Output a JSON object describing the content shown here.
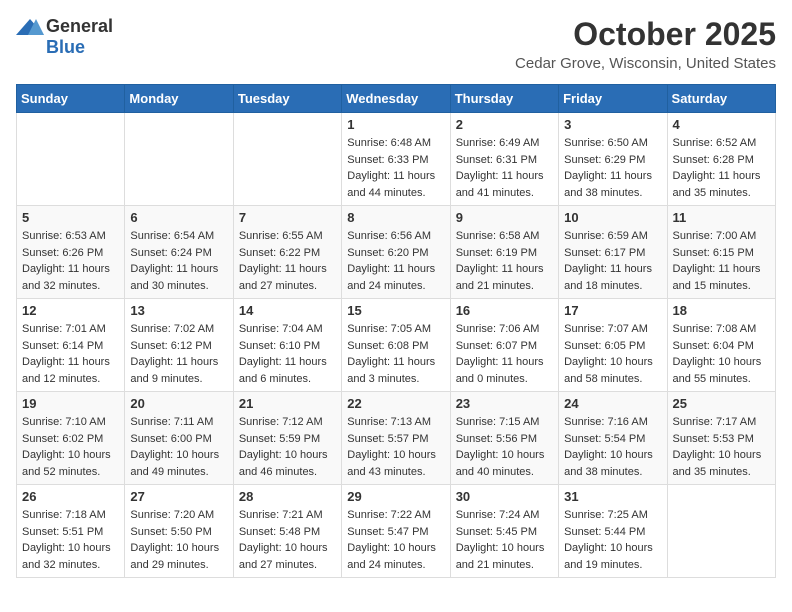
{
  "header": {
    "logo_general": "General",
    "logo_blue": "Blue",
    "month_title": "October 2025",
    "subtitle": "Cedar Grove, Wisconsin, United States"
  },
  "days_of_week": [
    "Sunday",
    "Monday",
    "Tuesday",
    "Wednesday",
    "Thursday",
    "Friday",
    "Saturday"
  ],
  "weeks": [
    [
      {
        "day": "",
        "info": ""
      },
      {
        "day": "",
        "info": ""
      },
      {
        "day": "",
        "info": ""
      },
      {
        "day": "1",
        "info": "Sunrise: 6:48 AM\nSunset: 6:33 PM\nDaylight: 11 hours\nand 44 minutes."
      },
      {
        "day": "2",
        "info": "Sunrise: 6:49 AM\nSunset: 6:31 PM\nDaylight: 11 hours\nand 41 minutes."
      },
      {
        "day": "3",
        "info": "Sunrise: 6:50 AM\nSunset: 6:29 PM\nDaylight: 11 hours\nand 38 minutes."
      },
      {
        "day": "4",
        "info": "Sunrise: 6:52 AM\nSunset: 6:28 PM\nDaylight: 11 hours\nand 35 minutes."
      }
    ],
    [
      {
        "day": "5",
        "info": "Sunrise: 6:53 AM\nSunset: 6:26 PM\nDaylight: 11 hours\nand 32 minutes."
      },
      {
        "day": "6",
        "info": "Sunrise: 6:54 AM\nSunset: 6:24 PM\nDaylight: 11 hours\nand 30 minutes."
      },
      {
        "day": "7",
        "info": "Sunrise: 6:55 AM\nSunset: 6:22 PM\nDaylight: 11 hours\nand 27 minutes."
      },
      {
        "day": "8",
        "info": "Sunrise: 6:56 AM\nSunset: 6:20 PM\nDaylight: 11 hours\nand 24 minutes."
      },
      {
        "day": "9",
        "info": "Sunrise: 6:58 AM\nSunset: 6:19 PM\nDaylight: 11 hours\nand 21 minutes."
      },
      {
        "day": "10",
        "info": "Sunrise: 6:59 AM\nSunset: 6:17 PM\nDaylight: 11 hours\nand 18 minutes."
      },
      {
        "day": "11",
        "info": "Sunrise: 7:00 AM\nSunset: 6:15 PM\nDaylight: 11 hours\nand 15 minutes."
      }
    ],
    [
      {
        "day": "12",
        "info": "Sunrise: 7:01 AM\nSunset: 6:14 PM\nDaylight: 11 hours\nand 12 minutes."
      },
      {
        "day": "13",
        "info": "Sunrise: 7:02 AM\nSunset: 6:12 PM\nDaylight: 11 hours\nand 9 minutes."
      },
      {
        "day": "14",
        "info": "Sunrise: 7:04 AM\nSunset: 6:10 PM\nDaylight: 11 hours\nand 6 minutes."
      },
      {
        "day": "15",
        "info": "Sunrise: 7:05 AM\nSunset: 6:08 PM\nDaylight: 11 hours\nand 3 minutes."
      },
      {
        "day": "16",
        "info": "Sunrise: 7:06 AM\nSunset: 6:07 PM\nDaylight: 11 hours\nand 0 minutes."
      },
      {
        "day": "17",
        "info": "Sunrise: 7:07 AM\nSunset: 6:05 PM\nDaylight: 10 hours\nand 58 minutes."
      },
      {
        "day": "18",
        "info": "Sunrise: 7:08 AM\nSunset: 6:04 PM\nDaylight: 10 hours\nand 55 minutes."
      }
    ],
    [
      {
        "day": "19",
        "info": "Sunrise: 7:10 AM\nSunset: 6:02 PM\nDaylight: 10 hours\nand 52 minutes."
      },
      {
        "day": "20",
        "info": "Sunrise: 7:11 AM\nSunset: 6:00 PM\nDaylight: 10 hours\nand 49 minutes."
      },
      {
        "day": "21",
        "info": "Sunrise: 7:12 AM\nSunset: 5:59 PM\nDaylight: 10 hours\nand 46 minutes."
      },
      {
        "day": "22",
        "info": "Sunrise: 7:13 AM\nSunset: 5:57 PM\nDaylight: 10 hours\nand 43 minutes."
      },
      {
        "day": "23",
        "info": "Sunrise: 7:15 AM\nSunset: 5:56 PM\nDaylight: 10 hours\nand 40 minutes."
      },
      {
        "day": "24",
        "info": "Sunrise: 7:16 AM\nSunset: 5:54 PM\nDaylight: 10 hours\nand 38 minutes."
      },
      {
        "day": "25",
        "info": "Sunrise: 7:17 AM\nSunset: 5:53 PM\nDaylight: 10 hours\nand 35 minutes."
      }
    ],
    [
      {
        "day": "26",
        "info": "Sunrise: 7:18 AM\nSunset: 5:51 PM\nDaylight: 10 hours\nand 32 minutes."
      },
      {
        "day": "27",
        "info": "Sunrise: 7:20 AM\nSunset: 5:50 PM\nDaylight: 10 hours\nand 29 minutes."
      },
      {
        "day": "28",
        "info": "Sunrise: 7:21 AM\nSunset: 5:48 PM\nDaylight: 10 hours\nand 27 minutes."
      },
      {
        "day": "29",
        "info": "Sunrise: 7:22 AM\nSunset: 5:47 PM\nDaylight: 10 hours\nand 24 minutes."
      },
      {
        "day": "30",
        "info": "Sunrise: 7:24 AM\nSunset: 5:45 PM\nDaylight: 10 hours\nand 21 minutes."
      },
      {
        "day": "31",
        "info": "Sunrise: 7:25 AM\nSunset: 5:44 PM\nDaylight: 10 hours\nand 19 minutes."
      },
      {
        "day": "",
        "info": ""
      }
    ]
  ]
}
